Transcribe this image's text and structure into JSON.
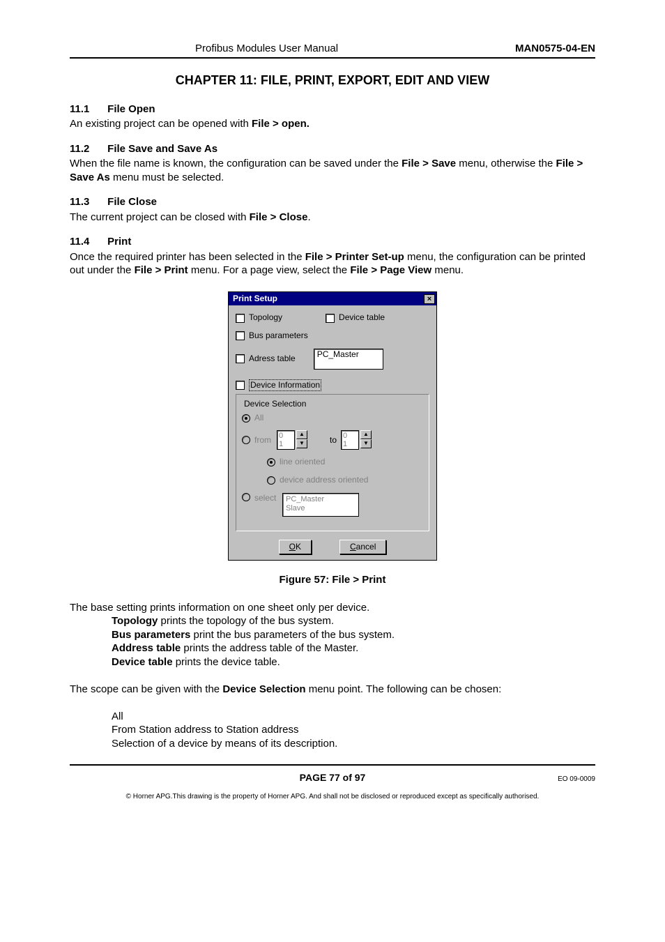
{
  "header": {
    "manual_title": "Profibus Modules User Manual",
    "doc_code": "MAN0575-04-EN"
  },
  "chapter_title": "CHAPTER 11: FILE, PRINT, EXPORT, EDIT AND VIEW",
  "s11_1": {
    "num": "11.1",
    "title": "File Open",
    "text_a": "An existing project can be opened with ",
    "bold_a": "File > open."
  },
  "s11_2": {
    "num": "11.2",
    "title": "File Save and Save As",
    "text_a": "When the file name is known, the configuration can be saved under the ",
    "bold_a": "File > Save",
    "text_b": " menu, otherwise the ",
    "bold_b": "File > Save As",
    "text_c": " menu must be selected."
  },
  "s11_3": {
    "num": "11.3",
    "title": "File Close",
    "text_a": "The current project can be closed with ",
    "bold_a": "File > Close",
    "text_b": "."
  },
  "s11_4": {
    "num": "11.4",
    "title": "Print",
    "text_a": "Once the required printer has been selected in the ",
    "bold_a": "File > Printer Set-up",
    "text_b": " menu, the configuration can be printed out under the ",
    "bold_b": "File > Print",
    "text_c": " menu.  For a page view, select the ",
    "bold_c": "File > Page View",
    "text_d": " menu."
  },
  "dialog": {
    "title": "Print Setup",
    "topology": "Topology",
    "device_table": "Device table",
    "bus_parameters": "Bus parameters",
    "address_table": "Adress table",
    "address_table_value": "PC_Master",
    "device_information": "Device Information",
    "device_selection_legend": "Device Selection",
    "all": "All",
    "from": "from",
    "to": "to",
    "spin_from_0": "0",
    "spin_from_1": "1",
    "spin_to_0": "0",
    "spin_to_1": "1",
    "line_oriented": "line oriented",
    "device_address_oriented": "device address oriented",
    "select": "select",
    "select_list_0": "PC_Master",
    "select_list_1": "Slave",
    "ok": "OK",
    "cancel": "Cancel"
  },
  "figure_caption": "Figure 57: File > Print",
  "post": {
    "line1": "The base setting prints information on one sheet only per device.",
    "topology_b": "Topology",
    "topology_t": " prints the topology of the bus system.",
    "bus_b": "Bus parameters",
    "bus_t": " print the bus parameters of the bus system.",
    "addr_b": "Address table",
    "addr_t": " prints the address table of the Master.",
    "dev_b": "Device table",
    "dev_t": " prints the device table.",
    "scope_a": "The scope can be given with the ",
    "scope_b": "Device Selection",
    "scope_c": " menu point. The following can be chosen:",
    "opt1": "All",
    "opt2": "From Station address to Station address",
    "opt3": "Selection of a device by means of its description."
  },
  "footer": {
    "page": "PAGE 77 of 97",
    "eo": "EO 09-0009",
    "copyright": "© Horner APG.This drawing is the property of Horner APG. And shall not be disclosed or reproduced except as specifically authorised."
  }
}
